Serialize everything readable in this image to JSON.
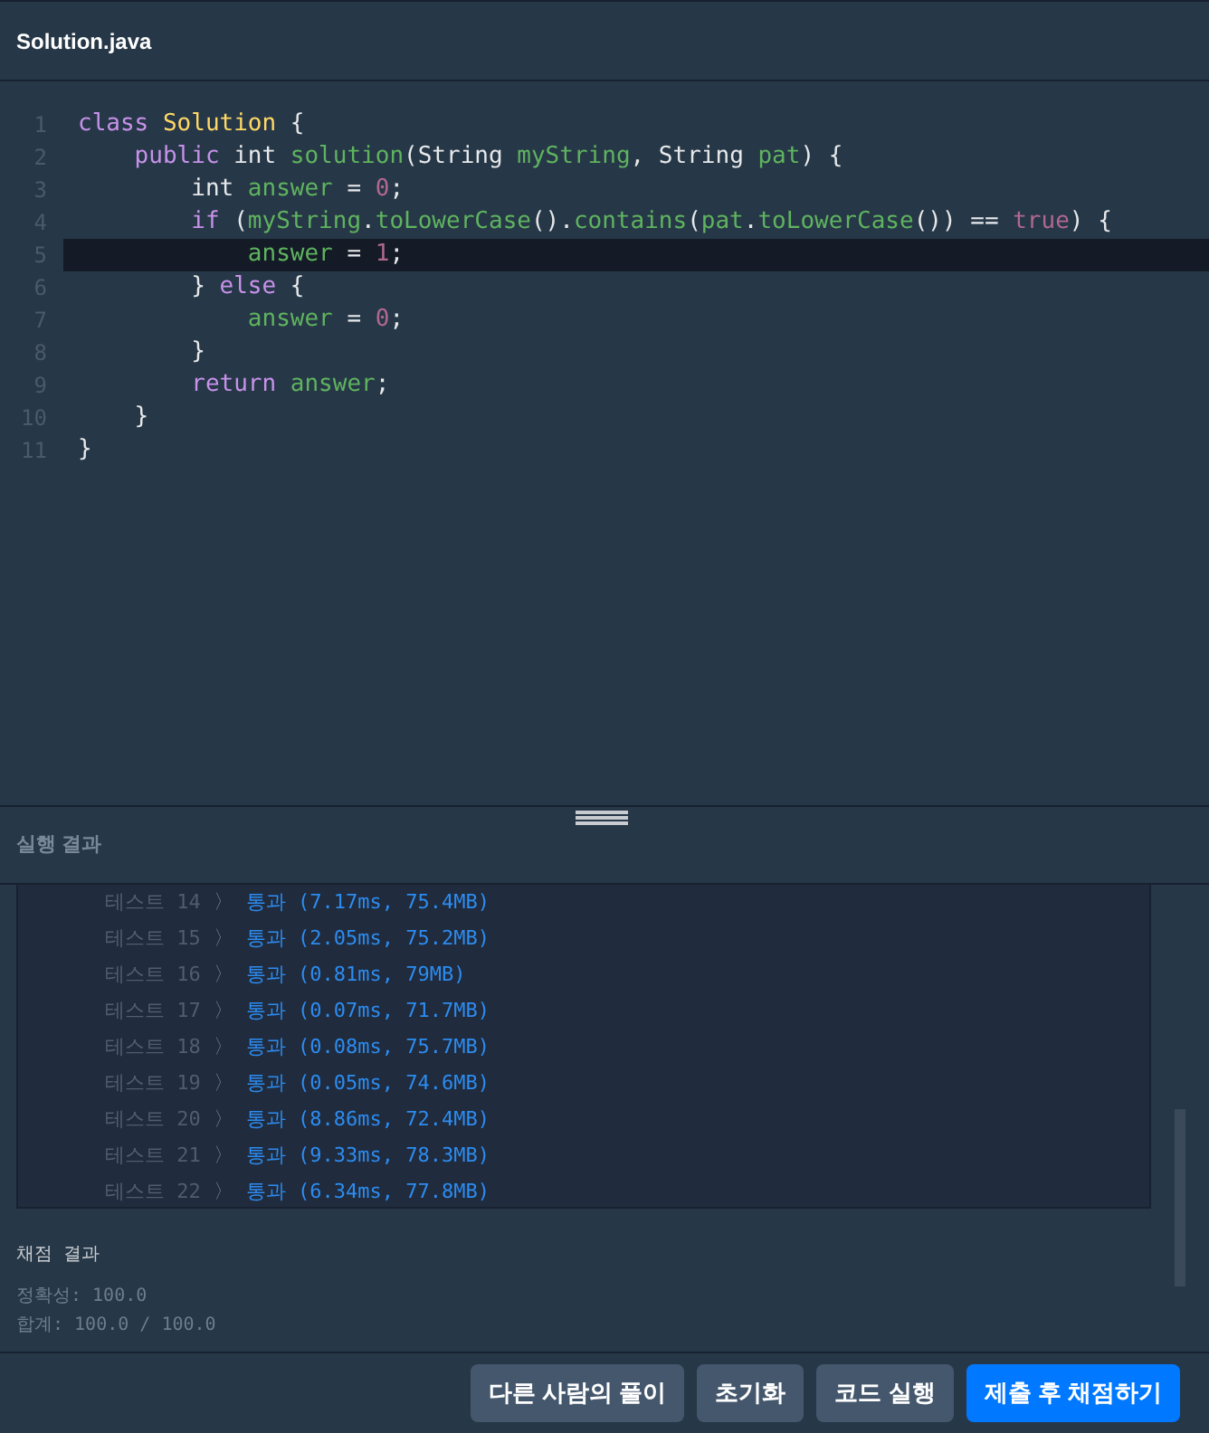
{
  "editor": {
    "filename": "Solution.java",
    "lines": [
      {
        "number": "1",
        "highlighted": false,
        "tokens": [
          {
            "text": "class ",
            "kind": "keyword"
          },
          {
            "text": "Solution",
            "kind": "type"
          },
          {
            "text": " {",
            "kind": "plain"
          }
        ]
      },
      {
        "number": "2",
        "highlighted": false,
        "tokens": [
          {
            "text": "    public ",
            "kind": "keyword"
          },
          {
            "text": "int ",
            "kind": "plain"
          },
          {
            "text": "solution",
            "kind": "ident"
          },
          {
            "text": "(String ",
            "kind": "plain"
          },
          {
            "text": "myString",
            "kind": "ident"
          },
          {
            "text": ", String ",
            "kind": "plain"
          },
          {
            "text": "pat",
            "kind": "ident"
          },
          {
            "text": ") {",
            "kind": "plain"
          }
        ]
      },
      {
        "number": "3",
        "highlighted": false,
        "tokens": [
          {
            "text": "        int ",
            "kind": "plain"
          },
          {
            "text": "answer",
            "kind": "ident"
          },
          {
            "text": " = ",
            "kind": "plain"
          },
          {
            "text": "0",
            "kind": "number"
          },
          {
            "text": ";",
            "kind": "plain"
          }
        ]
      },
      {
        "number": "4",
        "highlighted": false,
        "tokens": [
          {
            "text": "        if ",
            "kind": "keyword"
          },
          {
            "text": "(",
            "kind": "plain"
          },
          {
            "text": "myString",
            "kind": "ident"
          },
          {
            "text": ".",
            "kind": "plain"
          },
          {
            "text": "toLowerCase",
            "kind": "ident"
          },
          {
            "text": "().",
            "kind": "plain"
          },
          {
            "text": "contains",
            "kind": "ident"
          },
          {
            "text": "(",
            "kind": "plain"
          },
          {
            "text": "pat",
            "kind": "ident"
          },
          {
            "text": ".",
            "kind": "plain"
          },
          {
            "text": "toLowerCase",
            "kind": "ident"
          },
          {
            "text": "()) == ",
            "kind": "plain"
          },
          {
            "text": "true",
            "kind": "number"
          },
          {
            "text": ") {",
            "kind": "plain"
          }
        ]
      },
      {
        "number": "5",
        "highlighted": true,
        "tokens": [
          {
            "text": "            answer",
            "kind": "ident"
          },
          {
            "text": " = ",
            "kind": "plain"
          },
          {
            "text": "1",
            "kind": "number"
          },
          {
            "text": ";",
            "kind": "plain"
          }
        ]
      },
      {
        "number": "6",
        "highlighted": false,
        "tokens": [
          {
            "text": "        } ",
            "kind": "plain"
          },
          {
            "text": "else",
            "kind": "keyword"
          },
          {
            "text": " {",
            "kind": "plain"
          }
        ]
      },
      {
        "number": "7",
        "highlighted": false,
        "tokens": [
          {
            "text": "            answer",
            "kind": "ident"
          },
          {
            "text": " = ",
            "kind": "plain"
          },
          {
            "text": "0",
            "kind": "number"
          },
          {
            "text": ";",
            "kind": "plain"
          }
        ]
      },
      {
        "number": "8",
        "highlighted": false,
        "tokens": [
          {
            "text": "        }",
            "kind": "plain"
          }
        ]
      },
      {
        "number": "9",
        "highlighted": false,
        "tokens": [
          {
            "text": "        return ",
            "kind": "keyword"
          },
          {
            "text": "answer",
            "kind": "ident"
          },
          {
            "text": ";",
            "kind": "plain"
          }
        ]
      },
      {
        "number": "10",
        "highlighted": false,
        "tokens": [
          {
            "text": "    }",
            "kind": "plain"
          }
        ]
      },
      {
        "number": "11",
        "highlighted": false,
        "tokens": [
          {
            "text": "}",
            "kind": "plain"
          }
        ]
      }
    ]
  },
  "results": {
    "title": "실행 결과",
    "tests": [
      {
        "label": "테스트 14",
        "separator": "〉",
        "result": "통과 (7.17ms, 75.4MB)"
      },
      {
        "label": "테스트 15",
        "separator": "〉",
        "result": "통과 (2.05ms, 75.2MB)"
      },
      {
        "label": "테스트 16",
        "separator": "〉",
        "result": "통과 (0.81ms, 79MB)"
      },
      {
        "label": "테스트 17",
        "separator": "〉",
        "result": "통과 (0.07ms, 71.7MB)"
      },
      {
        "label": "테스트 18",
        "separator": "〉",
        "result": "통과 (0.08ms, 75.7MB)"
      },
      {
        "label": "테스트 19",
        "separator": "〉",
        "result": "통과 (0.05ms, 74.6MB)"
      },
      {
        "label": "테스트 20",
        "separator": "〉",
        "result": "통과 (8.86ms, 72.4MB)"
      },
      {
        "label": "테스트 21",
        "separator": "〉",
        "result": "통과 (9.33ms, 78.3MB)"
      },
      {
        "label": "테스트 22",
        "separator": "〉",
        "result": "통과 (6.34ms, 77.8MB)"
      }
    ],
    "score_title": "채점 결과",
    "score_lines": [
      "정확성: 100.0",
      "합계: 100.0 / 100.0"
    ]
  },
  "buttons": [
    {
      "label": "다른 사람의 풀이",
      "kind": "secondary"
    },
    {
      "label": "초기화",
      "kind": "secondary"
    },
    {
      "label": "코드 실행",
      "kind": "secondary"
    },
    {
      "label": "제출 후 채점하기",
      "kind": "primary"
    }
  ]
}
